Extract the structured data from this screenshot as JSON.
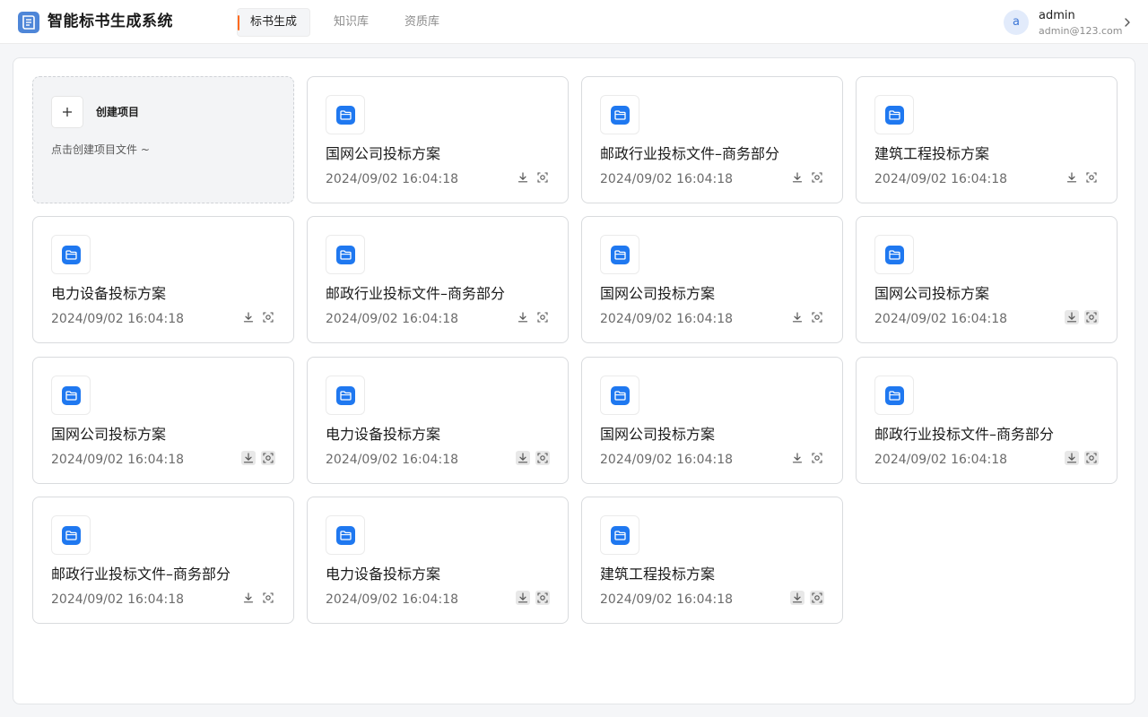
{
  "app": {
    "title": "智能标书生成系统"
  },
  "nav": {
    "tabs": [
      {
        "label": "标书生成",
        "active": true
      },
      {
        "label": "知识库"
      },
      {
        "label": "资质库"
      }
    ]
  },
  "user": {
    "avatar_initial": "a",
    "name": "admin",
    "email": "admin@123.com"
  },
  "create_card": {
    "title": "创建项目",
    "description": "点击创建项目文件 ~"
  },
  "projects": [
    {
      "title": "国网公司投标方案",
      "date": "2024/09/02 16:04:18"
    },
    {
      "title": "邮政行业投标文件–商务部分",
      "date": "2024/09/02 16:04:18"
    },
    {
      "title": "建筑工程投标方案",
      "date": "2024/09/02 16:04:18"
    },
    {
      "title": "电力设备投标方案",
      "date": "2024/09/02 16:04:18"
    },
    {
      "title": "邮政行业投标文件–商务部分",
      "date": "2024/09/02 16:04:18"
    },
    {
      "title": "国网公司投标方案",
      "date": "2024/09/02 16:04:18"
    },
    {
      "title": "国网公司投标方案",
      "date": "2024/09/02 16:04:18"
    },
    {
      "title": "国网公司投标方案",
      "date": "2024/09/02 16:04:18"
    },
    {
      "title": "电力设备投标方案",
      "date": "2024/09/02 16:04:18"
    },
    {
      "title": "国网公司投标方案",
      "date": "2024/09/02 16:04:18"
    },
    {
      "title": "邮政行业投标文件–商务部分",
      "date": "2024/09/02 16:04:18"
    },
    {
      "title": "邮政行业投标文件–商务部分",
      "date": "2024/09/02 16:04:18"
    },
    {
      "title": "电力设备投标方案",
      "date": "2024/09/02 16:04:18"
    },
    {
      "title": "建筑工程投标方案",
      "date": "2024/09/02 16:04:18"
    }
  ],
  "icons": {
    "logo": "book-icon",
    "folder": "folder-icon",
    "download": "download-icon",
    "preview": "scan-icon",
    "chevron": "chevron-right-icon",
    "plus": "plus-icon"
  },
  "colors": {
    "accent": "#ff6a1f",
    "folder_blue": "#1f78f0",
    "logo_blue": "#4e86d8"
  }
}
